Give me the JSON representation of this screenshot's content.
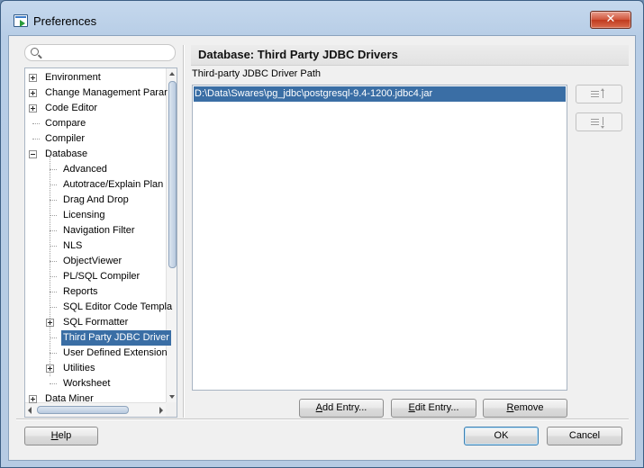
{
  "window": {
    "title": "Preferences",
    "close_glyph": "✕",
    "icon": "preferences-app-icon"
  },
  "search": {
    "value": "",
    "placeholder": "",
    "icon": "search-icon"
  },
  "tree": {
    "items": [
      {
        "label": "Environment",
        "expander": "plus"
      },
      {
        "label": "Change Management Parar",
        "expander": "plus"
      },
      {
        "label": "Code Editor",
        "expander": "plus"
      },
      {
        "label": "Compare",
        "expander": "none"
      },
      {
        "label": "Compiler",
        "expander": "none"
      },
      {
        "label": "Database",
        "expander": "minus"
      },
      {
        "label": "Advanced",
        "expander": "none"
      },
      {
        "label": "Autotrace/Explain Plan",
        "expander": "none"
      },
      {
        "label": "Drag And Drop",
        "expander": "none"
      },
      {
        "label": "Licensing",
        "expander": "none"
      },
      {
        "label": "Navigation Filter",
        "expander": "none"
      },
      {
        "label": "NLS",
        "expander": "none"
      },
      {
        "label": "ObjectViewer",
        "expander": "none"
      },
      {
        "label": "PL/SQL Compiler",
        "expander": "none"
      },
      {
        "label": "Reports",
        "expander": "none"
      },
      {
        "label": "SQL Editor Code Templa",
        "expander": "none"
      },
      {
        "label": "SQL Formatter",
        "expander": "plus"
      },
      {
        "label": "Third Party JDBC Driver",
        "expander": "none",
        "selected": true
      },
      {
        "label": "User Defined Extension",
        "expander": "none"
      },
      {
        "label": "Utilities",
        "expander": "plus"
      },
      {
        "label": "Worksheet",
        "expander": "none"
      },
      {
        "label": "Data Miner",
        "expander": "plus"
      }
    ]
  },
  "page": {
    "title": "Database: Third Party JDBC Drivers",
    "section_label": "Third-party JDBC Driver Path",
    "paths": [
      "D:\\Data\\Swares\\pg_jdbc\\postgresql-9.4-1200.jdbc4.jar"
    ],
    "move_up_icon": "move-up-icon",
    "move_down_icon": "move-down-icon"
  },
  "actions": {
    "add_entry": {
      "mnemonic": "A",
      "rest": "dd Entry..."
    },
    "edit_entry": {
      "mnemonic": "E",
      "rest": "dit Entry..."
    },
    "remove": {
      "mnemonic": "R",
      "rest": "emove"
    }
  },
  "footer": {
    "help": {
      "mnemonic": "H",
      "rest": "elp"
    },
    "ok": "OK",
    "cancel": "Cancel"
  },
  "colors": {
    "selection": "#3a6ea5",
    "window_frame": "#b7cde6",
    "close_button": "#c84a2e"
  }
}
